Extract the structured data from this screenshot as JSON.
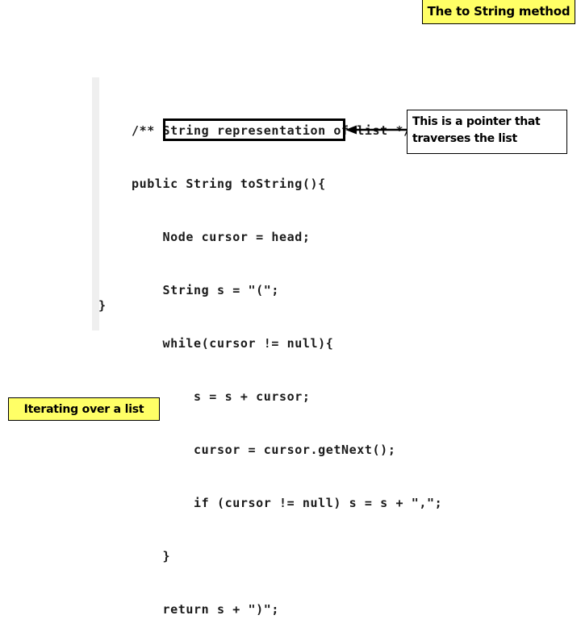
{
  "slide": {
    "title": "The to String method",
    "footer_caption": "Iterating over a list",
    "colors": {
      "highlight_yellow": "#ffff66",
      "text_black": "#000000",
      "rule_gray": "#efefef",
      "background": "#ffffff"
    }
  },
  "code": {
    "lines": [
      "/** String representation of list */",
      "public String toString(){",
      "    Node cursor = head;",
      "    String s = \"(\";",
      "    while(cursor != null){",
      "        s = s + cursor;",
      "        cursor = cursor.getNext();",
      "        if (cursor != null) s = s + \",\";",
      "    }",
      "    return s + \")\";"
    ],
    "closing_brace": "}",
    "highlighted_line": "Node cursor = head;"
  },
  "callout": {
    "lines": [
      "This is a pointer that",
      "traverses the list"
    ],
    "points_to": "Node cursor = head;"
  }
}
